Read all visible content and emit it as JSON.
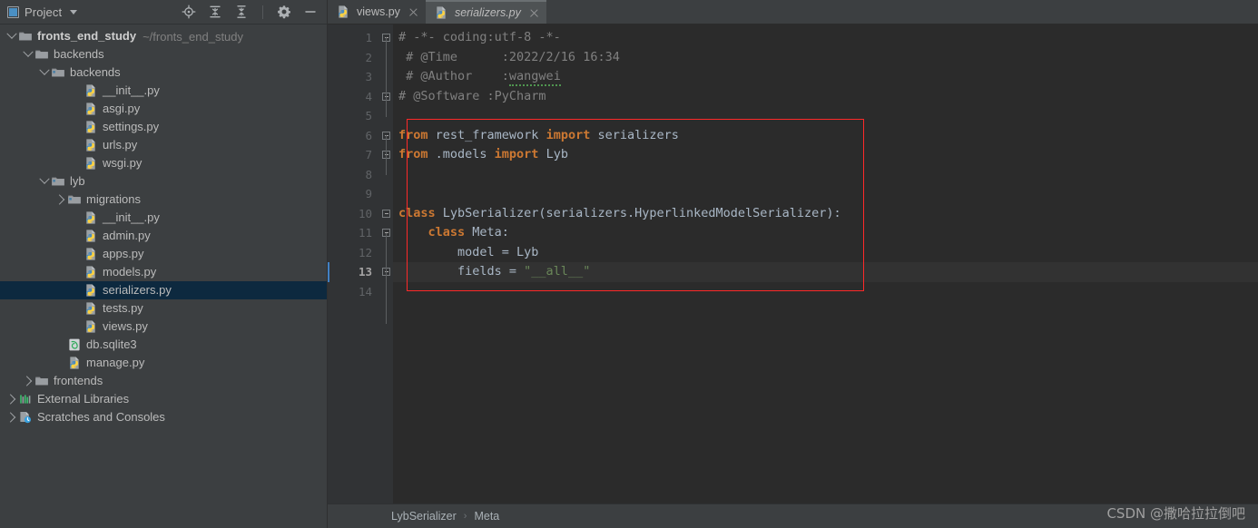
{
  "panel": {
    "title": "Project",
    "icon": "project-window-icon",
    "tools": [
      {
        "name": "locate-icon",
        "title": "Select Opened File"
      },
      {
        "name": "expand-all-icon",
        "title": "Expand All"
      },
      {
        "name": "collapse-all-icon",
        "title": "Collapse All"
      },
      {
        "name": "gear-icon",
        "title": "Options"
      },
      {
        "name": "minimize-icon",
        "title": "Hide"
      }
    ]
  },
  "tree": [
    {
      "indent": 0,
      "twisty": "open",
      "icon": "folder",
      "label": "fronts_end_study",
      "bold": true,
      "sub": "~/fronts_end_study",
      "selected": false
    },
    {
      "indent": 1,
      "twisty": "open",
      "icon": "folder",
      "label": "backends",
      "bold": false,
      "sub": "",
      "selected": false
    },
    {
      "indent": 2,
      "twisty": "open",
      "icon": "module",
      "label": "backends",
      "bold": false,
      "sub": "",
      "selected": false
    },
    {
      "indent": 4,
      "twisty": "none",
      "icon": "python",
      "label": "__init__.py",
      "bold": false,
      "sub": "",
      "selected": false
    },
    {
      "indent": 4,
      "twisty": "none",
      "icon": "python",
      "label": "asgi.py",
      "bold": false,
      "sub": "",
      "selected": false
    },
    {
      "indent": 4,
      "twisty": "none",
      "icon": "python",
      "label": "settings.py",
      "bold": false,
      "sub": "",
      "selected": false
    },
    {
      "indent": 4,
      "twisty": "none",
      "icon": "python",
      "label": "urls.py",
      "bold": false,
      "sub": "",
      "selected": false
    },
    {
      "indent": 4,
      "twisty": "none",
      "icon": "python",
      "label": "wsgi.py",
      "bold": false,
      "sub": "",
      "selected": false
    },
    {
      "indent": 2,
      "twisty": "open",
      "icon": "module",
      "label": "lyb",
      "bold": false,
      "sub": "",
      "selected": false
    },
    {
      "indent": 3,
      "twisty": "closed",
      "icon": "module",
      "label": "migrations",
      "bold": false,
      "sub": "",
      "selected": false
    },
    {
      "indent": 4,
      "twisty": "none",
      "icon": "python",
      "label": "__init__.py",
      "bold": false,
      "sub": "",
      "selected": false
    },
    {
      "indent": 4,
      "twisty": "none",
      "icon": "python",
      "label": "admin.py",
      "bold": false,
      "sub": "",
      "selected": false
    },
    {
      "indent": 4,
      "twisty": "none",
      "icon": "python",
      "label": "apps.py",
      "bold": false,
      "sub": "",
      "selected": false
    },
    {
      "indent": 4,
      "twisty": "none",
      "icon": "python",
      "label": "models.py",
      "bold": false,
      "sub": "",
      "selected": false
    },
    {
      "indent": 4,
      "twisty": "none",
      "icon": "python",
      "label": "serializers.py",
      "bold": false,
      "sub": "",
      "selected": true
    },
    {
      "indent": 4,
      "twisty": "none",
      "icon": "python",
      "label": "tests.py",
      "bold": false,
      "sub": "",
      "selected": false
    },
    {
      "indent": 4,
      "twisty": "none",
      "icon": "python",
      "label": "views.py",
      "bold": false,
      "sub": "",
      "selected": false
    },
    {
      "indent": 3,
      "twisty": "none",
      "icon": "sqlite",
      "label": "db.sqlite3",
      "bold": false,
      "sub": "",
      "selected": false
    },
    {
      "indent": 3,
      "twisty": "none",
      "icon": "python",
      "label": "manage.py",
      "bold": false,
      "sub": "",
      "selected": false
    },
    {
      "indent": 1,
      "twisty": "closed",
      "icon": "folder",
      "label": "frontends",
      "bold": false,
      "sub": "",
      "selected": false
    },
    {
      "indent": 0,
      "twisty": "closed",
      "icon": "library",
      "label": "External Libraries",
      "bold": false,
      "sub": "",
      "selected": false
    },
    {
      "indent": 0,
      "twisty": "closed",
      "icon": "scratch",
      "label": "Scratches and Consoles",
      "bold": false,
      "sub": "",
      "selected": false
    }
  ],
  "tabs": [
    {
      "label": "views.py",
      "icon": "python-file-icon",
      "active": false
    },
    {
      "label": "serializers.py",
      "icon": "python-file-icon",
      "active": true
    }
  ],
  "editor": {
    "line_numbers": [
      "1",
      "2",
      "3",
      "4",
      "5",
      "6",
      "7",
      "8",
      "9",
      "10",
      "11",
      "12",
      "13",
      "14"
    ],
    "current_line": 13,
    "lines": [
      {
        "n": 1,
        "parts": [
          {
            "t": "# -*- coding:utf-8 -*-",
            "c": "cmt"
          }
        ]
      },
      {
        "n": 2,
        "parts": [
          {
            "t": " # @Time      :2022/2/16 16:34",
            "c": "cmt"
          }
        ]
      },
      {
        "n": 3,
        "parts": [
          {
            "t": " # @Author    :",
            "c": "cmt"
          },
          {
            "t": "wangwei",
            "c": "cmt-spell"
          }
        ]
      },
      {
        "n": 4,
        "parts": [
          {
            "t": "# @Software :PyCharm",
            "c": "cmt"
          }
        ]
      },
      {
        "n": 5,
        "parts": [
          {
            "t": "",
            "c": "plain"
          }
        ]
      },
      {
        "n": 6,
        "parts": [
          {
            "t": "from",
            "c": "kw"
          },
          {
            "t": " rest_framework ",
            "c": "plain"
          },
          {
            "t": "import",
            "c": "kw"
          },
          {
            "t": " serializers",
            "c": "plain"
          }
        ]
      },
      {
        "n": 7,
        "parts": [
          {
            "t": "from",
            "c": "kw"
          },
          {
            "t": " .models ",
            "c": "plain"
          },
          {
            "t": "import",
            "c": "kw"
          },
          {
            "t": " Lyb",
            "c": "plain"
          }
        ]
      },
      {
        "n": 8,
        "parts": [
          {
            "t": "",
            "c": "plain"
          }
        ]
      },
      {
        "n": 9,
        "parts": [
          {
            "t": "",
            "c": "plain"
          }
        ]
      },
      {
        "n": 10,
        "parts": [
          {
            "t": "class",
            "c": "kw"
          },
          {
            "t": " LybSerializer(serializers.HyperlinkedModelSerializer):",
            "c": "plain"
          }
        ]
      },
      {
        "n": 11,
        "parts": [
          {
            "t": "    ",
            "c": "plain"
          },
          {
            "t": "class",
            "c": "kw"
          },
          {
            "t": " Meta:",
            "c": "plain"
          }
        ]
      },
      {
        "n": 12,
        "parts": [
          {
            "t": "        model = Lyb",
            "c": "plain"
          }
        ]
      },
      {
        "n": 13,
        "parts": [
          {
            "t": "        fields = ",
            "c": "plain"
          },
          {
            "t": "\"__all__\"",
            "c": "str"
          }
        ]
      },
      {
        "n": 14,
        "parts": [
          {
            "t": "",
            "c": "plain"
          }
        ]
      }
    ],
    "highlight_box": {
      "label": "red-annotation-box",
      "color": "#fd2929"
    }
  },
  "breadcrumb": {
    "items": [
      "LybSerializer",
      "Meta"
    ],
    "separator": "›"
  },
  "watermark": "CSDN @撒哈拉拉倒吧",
  "colors": {
    "panel_bg": "#3c3f41",
    "editor_bg": "#2b2b2b",
    "gutter_bg": "#313335",
    "selection": "#0d293f",
    "keyword": "#cc7832",
    "string": "#6a8759",
    "comment": "#808080",
    "text": "#a9b7c6",
    "annotation": "#fd2929"
  }
}
